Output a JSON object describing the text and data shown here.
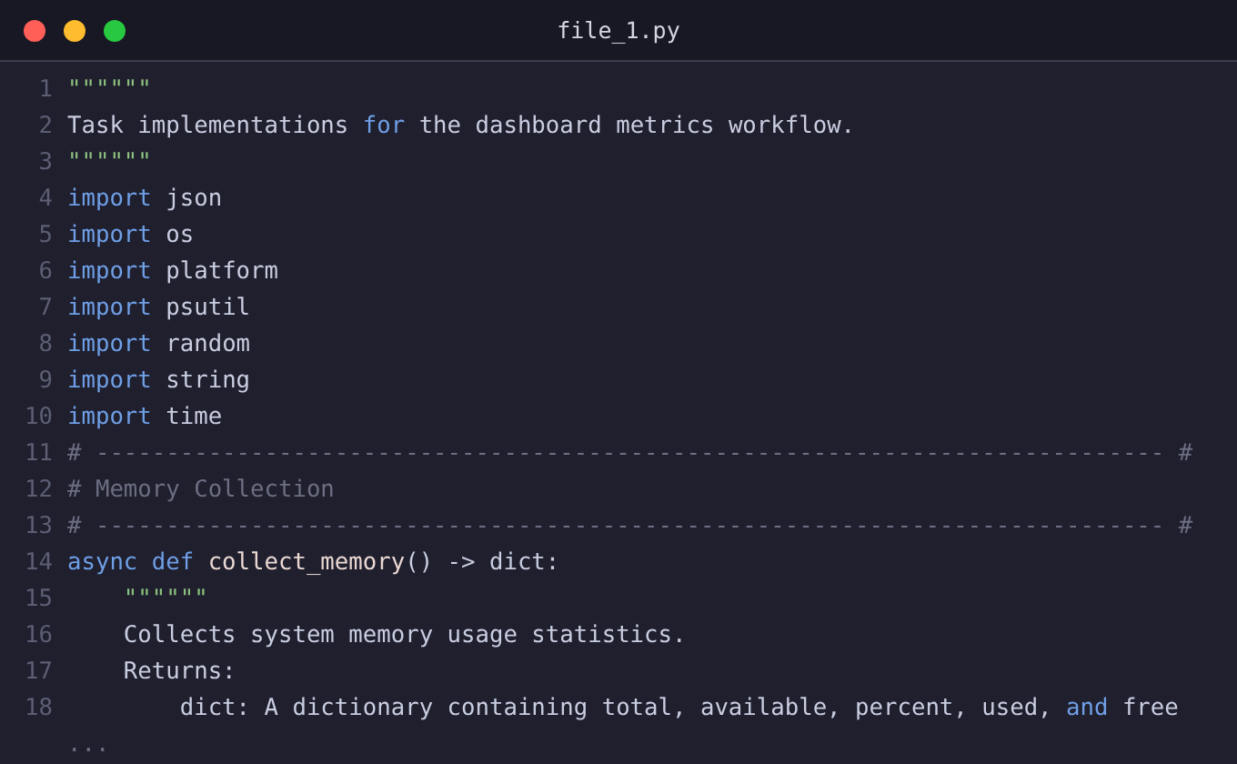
{
  "window": {
    "title": "file_1.py"
  },
  "lines": [
    {
      "number": "1",
      "tokens": [
        {
          "kind": "string",
          "text": "\"\"\"\"\"\""
        }
      ]
    },
    {
      "number": "2",
      "tokens": [
        {
          "kind": "text",
          "text": "Task implementations "
        },
        {
          "kind": "keyword",
          "text": "for"
        },
        {
          "kind": "text",
          "text": " the dashboard metrics workflow."
        }
      ]
    },
    {
      "number": "3",
      "tokens": [
        {
          "kind": "string",
          "text": "\"\"\"\"\"\""
        }
      ]
    },
    {
      "number": "4",
      "tokens": [
        {
          "kind": "keyword",
          "text": "import"
        },
        {
          "kind": "text",
          "text": " json"
        }
      ]
    },
    {
      "number": "5",
      "tokens": [
        {
          "kind": "keyword",
          "text": "import"
        },
        {
          "kind": "text",
          "text": " os"
        }
      ]
    },
    {
      "number": "6",
      "tokens": [
        {
          "kind": "keyword",
          "text": "import"
        },
        {
          "kind": "text",
          "text": " platform"
        }
      ]
    },
    {
      "number": "7",
      "tokens": [
        {
          "kind": "keyword",
          "text": "import"
        },
        {
          "kind": "text",
          "text": " psutil"
        }
      ]
    },
    {
      "number": "8",
      "tokens": [
        {
          "kind": "keyword",
          "text": "import"
        },
        {
          "kind": "text",
          "text": " random"
        }
      ]
    },
    {
      "number": "9",
      "tokens": [
        {
          "kind": "keyword",
          "text": "import"
        },
        {
          "kind": "text",
          "text": " string"
        }
      ]
    },
    {
      "number": "10",
      "tokens": [
        {
          "kind": "keyword",
          "text": "import"
        },
        {
          "kind": "text",
          "text": " time"
        }
      ]
    },
    {
      "number": "11",
      "tokens": [
        {
          "kind": "comment",
          "text": "# ---------------------------------------------------------------------------- #"
        }
      ]
    },
    {
      "number": "12",
      "tokens": [
        {
          "kind": "comment",
          "text": "# Memory Collection"
        }
      ]
    },
    {
      "number": "13",
      "tokens": [
        {
          "kind": "comment",
          "text": "# ---------------------------------------------------------------------------- #"
        }
      ]
    },
    {
      "number": "14",
      "tokens": [
        {
          "kind": "keyword",
          "text": "async def"
        },
        {
          "kind": "function",
          "text": " collect_memory"
        },
        {
          "kind": "text",
          "text": "() -> dict:"
        }
      ]
    },
    {
      "number": "15",
      "tokens": [
        {
          "kind": "string",
          "text": "    \"\"\"\"\"\""
        }
      ]
    },
    {
      "number": "16",
      "tokens": [
        {
          "kind": "text",
          "text": "    Collects system memory usage statistics."
        }
      ]
    },
    {
      "number": "17",
      "tokens": [
        {
          "kind": "text",
          "text": "    Returns:"
        }
      ]
    },
    {
      "number": "18",
      "tokens": [
        {
          "kind": "text",
          "text": "        dict: A dictionary containing total, available, percent, used, "
        },
        {
          "kind": "keyword",
          "text": "and"
        },
        {
          "kind": "text",
          "text": " free"
        }
      ]
    }
  ],
  "more": "..."
}
